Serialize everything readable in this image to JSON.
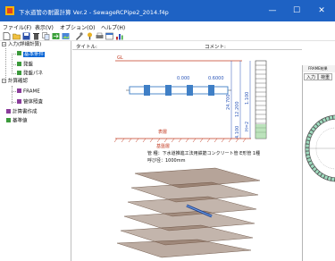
{
  "window": {
    "title": "下水道管の耐震計算 Ver.2 - SewageRCPipe2_2014.f4p",
    "minimize": "—",
    "maximize": "☐",
    "close": "✕"
  },
  "menu": [
    "ファイル(F)",
    "表示(V)",
    "オプション(O)",
    "ヘルプ(H)"
  ],
  "toolbar": [
    "new-file-icon",
    "open-folder-icon",
    "save-icon",
    "delete-icon",
    "copy-icon",
    "export-icon",
    "image-icon",
    "settings-icon",
    "help-icon",
    "print-icon",
    "window-icon",
    "chart-icon"
  ],
  "tree": {
    "root1": "入力(詳細計算)",
    "children1": [
      "基本条件",
      "発盤",
      "発盤パネ"
    ],
    "root2": "計算確認",
    "children2": [
      "FRAME",
      "管体照査"
    ],
    "leaf1": "計算書作成",
    "leaf2": "基準値"
  },
  "drawing": {
    "title_label": "タイトル:",
    "comment_label": "コメント:",
    "gl": "GL",
    "dim_a": "0.000",
    "dim_b": "0.6000",
    "dim_c": "24.700",
    "dim_d": "12.200",
    "dim_e": "4.100",
    "dim_f": "1.100",
    "dim_g": "H=2",
    "layer": "表層",
    "base": "基盤層",
    "pipe_type": "管 種：下水道推進工法用鉄筋コンクリート管 E形管 1種",
    "pipe_size": "呼び径：1000mm"
  },
  "frame_window": {
    "title": "FRAME結果",
    "tabs": [
      "入力",
      "荷重"
    ]
  },
  "colors": {
    "titlebar": "#1e62c4",
    "selection": "#0a66d6",
    "node_green": "#3c9a3c",
    "node_purple": "#8a3c9a",
    "pipe": "#3f7fc6",
    "ground": "#c23b22"
  }
}
